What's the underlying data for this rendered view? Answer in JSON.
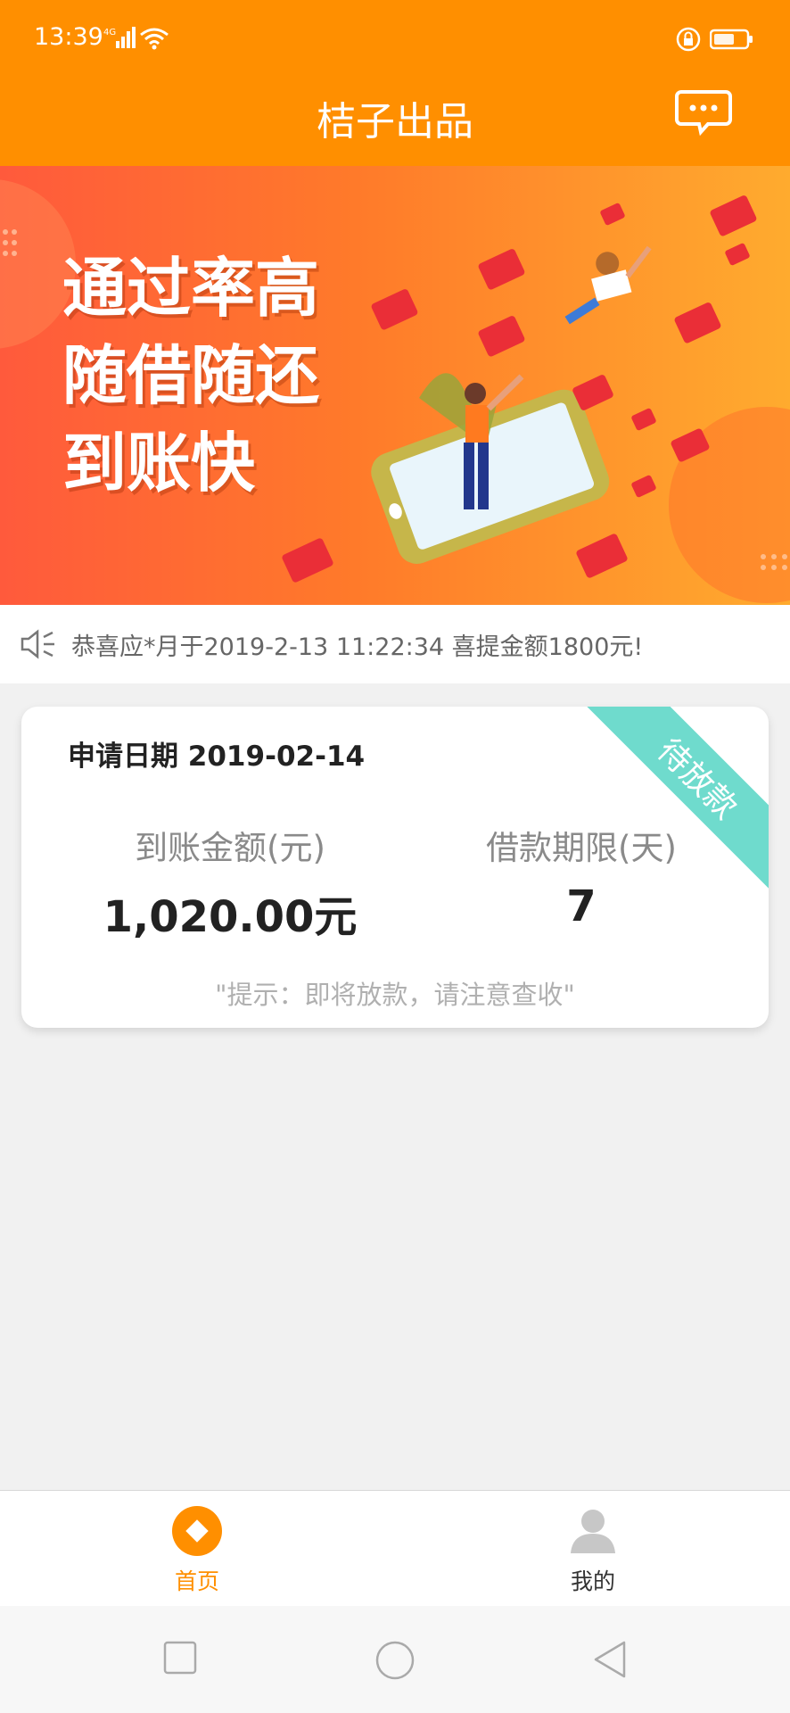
{
  "status_bar": {
    "time": "13:39",
    "network": "4G"
  },
  "header": {
    "title": "桔子出品",
    "chat_icon": "chat-bubble-icon"
  },
  "banner": {
    "lines": [
      "通过率高",
      "随借随还",
      "到账快"
    ]
  },
  "notice": {
    "icon": "speaker-icon",
    "text": "恭喜应*月于2019-2-13 11:22:34 喜提金额1800元!"
  },
  "loan_card": {
    "date_label": "申请日期 2019-02-14",
    "status": "待放款",
    "amount_label": "到账金额(元)",
    "amount_value": "1,020.00元",
    "term_label": "借款期限(天)",
    "term_value": "7",
    "tip": "\"提示：即将放款，请注意查收\""
  },
  "tabbar": {
    "items": [
      {
        "label": "首页",
        "icon": "home-diamond-icon",
        "active": true
      },
      {
        "label": "我的",
        "icon": "user-icon",
        "active": false
      }
    ]
  },
  "colors": {
    "brand": "#ff8f00",
    "ribbon": "#6fdbcd",
    "background": "#f1f1f1"
  }
}
